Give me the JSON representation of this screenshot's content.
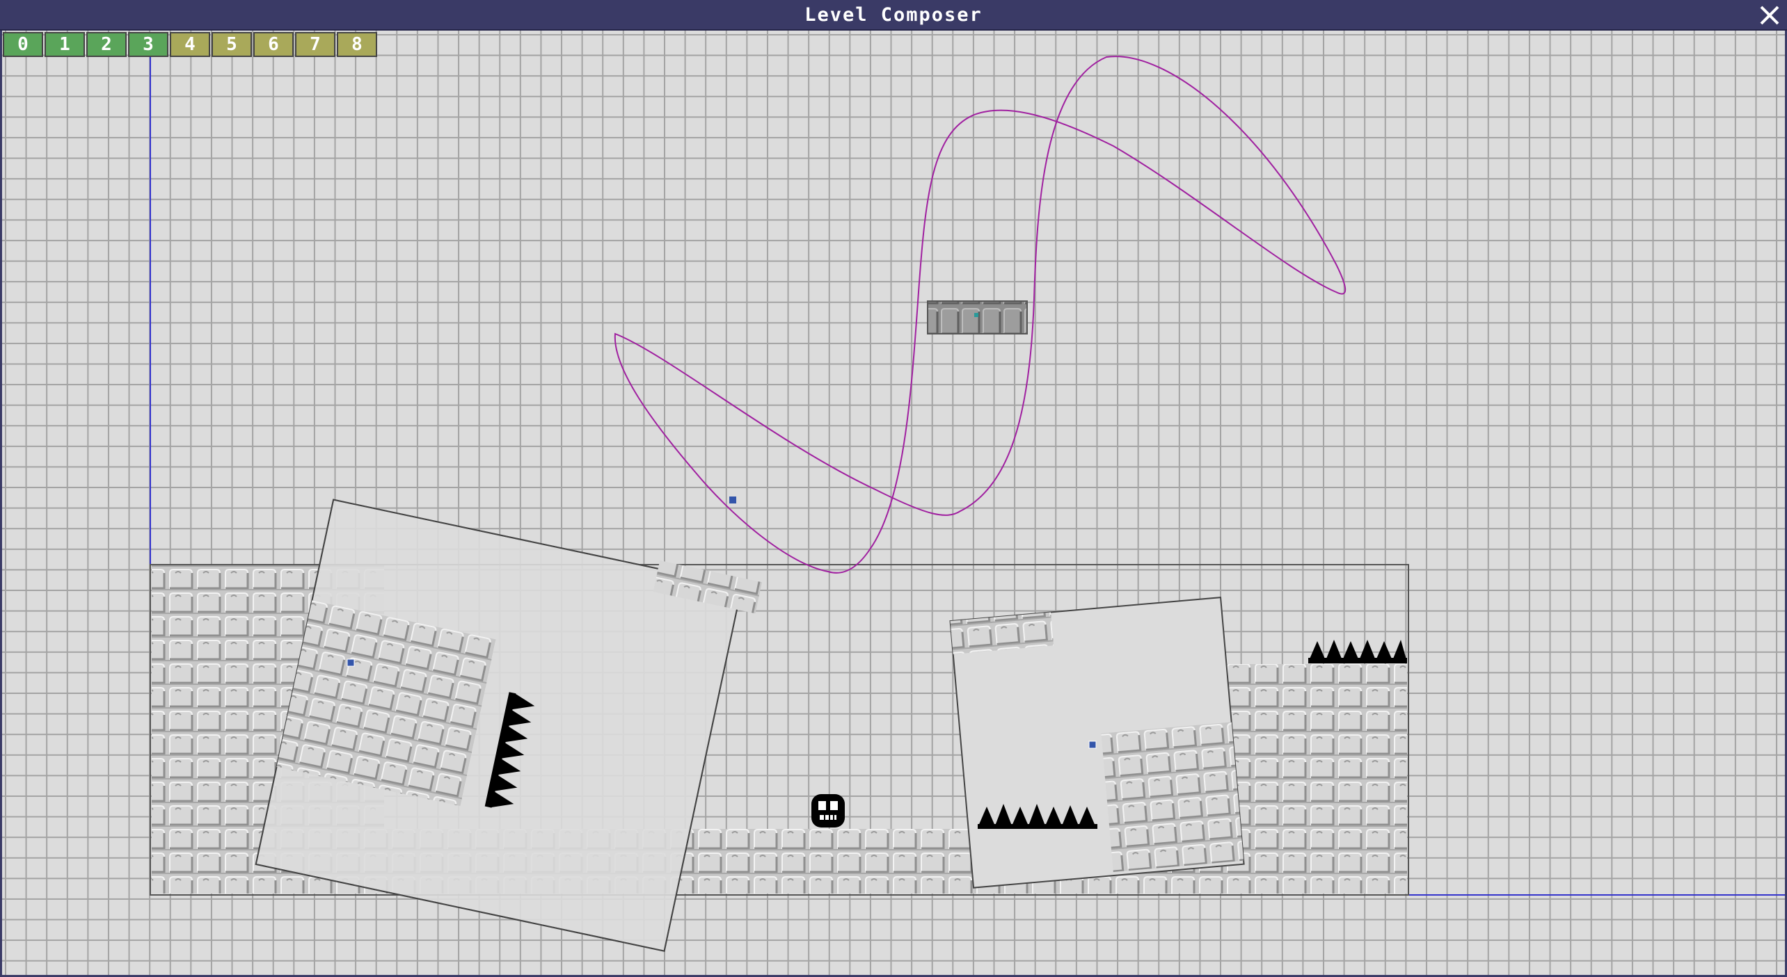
{
  "window": {
    "title": "Level Composer",
    "close_icon": "close-x-icon",
    "title_bar_color": "#3a3a66"
  },
  "layer_bar": {
    "tabs": [
      {
        "label": "0",
        "state": "active"
      },
      {
        "label": "1",
        "state": "active"
      },
      {
        "label": "2",
        "state": "active"
      },
      {
        "label": "3",
        "state": "active"
      },
      {
        "label": "4",
        "state": "inactive"
      },
      {
        "label": "5",
        "state": "inactive"
      },
      {
        "label": "6",
        "state": "inactive"
      },
      {
        "label": "7",
        "state": "inactive"
      },
      {
        "label": "8",
        "state": "inactive"
      }
    ],
    "active_color": "#5aa55a",
    "inactive_color": "#a9a95a"
  },
  "colors": {
    "grid_background": "#dcdcdc",
    "grid_line": "#a3a3a3",
    "axis_line": "#3333cc",
    "path_line": "#a020a0",
    "brick_fill": "#c8c8c8",
    "brick_dark": "#9a9a9a",
    "brick_light": "#f0f0f0",
    "spike_fill": "#000000",
    "handle_fill": "#3355aa",
    "moving_platform": "#9a9a9a"
  },
  "scene": {
    "objects": [
      {
        "kind": "brick-wall",
        "name": "left-wall"
      },
      {
        "kind": "brick-floor",
        "name": "bottom-floor"
      },
      {
        "kind": "brick-wall",
        "name": "right-wall"
      },
      {
        "kind": "rotating-frame",
        "name": "left-rotating-frame"
      },
      {
        "kind": "rotating-frame",
        "name": "right-rotating-frame"
      },
      {
        "kind": "spike-row",
        "name": "spike-row-top-right"
      },
      {
        "kind": "spike-row",
        "name": "spike-row-bottom"
      },
      {
        "kind": "spike-column",
        "name": "spike-column-left"
      },
      {
        "kind": "moving-platform",
        "name": "moving-platform"
      },
      {
        "kind": "motion-path",
        "name": "platform-motion-path"
      },
      {
        "kind": "player",
        "name": "player-character",
        "icon": "skull-face-icon"
      }
    ]
  }
}
